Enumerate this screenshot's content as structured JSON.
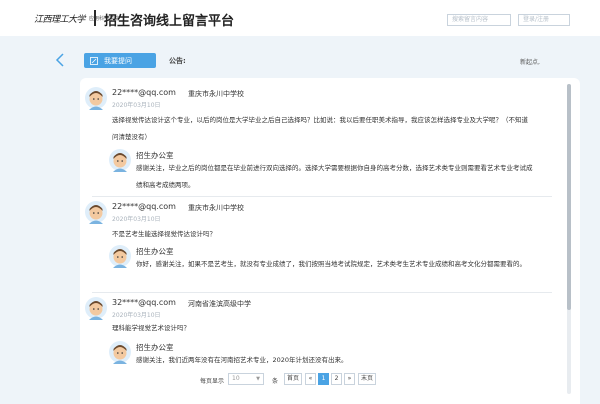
{
  "header": {
    "logo_text": "江西理工大学",
    "logo_sub": "应用科学学院",
    "title": "招生咨询线上留言平台",
    "search_placeholder": "搜索留言内容",
    "user_placeholder": "登录/注册"
  },
  "toolbar": {
    "ask_label": "我要提问",
    "notice_label": "公告:",
    "notice_text": "新起点,"
  },
  "messages": [
    {
      "email": "22****@qq.com",
      "school": "重庆市永川中学校",
      "date": "2020年03月10日",
      "question": "选择视觉传达设计这个专业，以后的岗位是大学毕业之后自己选择吗？比如说：我以后要任职美术指导，我应该怎样选择专业及大学呢？（不知道问清楚没有）",
      "reply_name": "招生办公室",
      "reply": "感谢关注，毕业之后的岗位都是在毕业前进行双向选择的。选择大学需要根据你自身的高考分数，选择艺术类专业则需要看艺术专业考试成绩和高考成绩两项。"
    },
    {
      "email": "22****@qq.com",
      "school": "重庆市永川中学校",
      "date": "2020年03月10日",
      "question": "不是艺考生能选择视觉传达设计吗？",
      "reply_name": "招生办公室",
      "reply": "你好，感谢关注，如果不是艺考生，就没有专业成绩了，我们按照当地考试院规定，艺术类考生艺术专业成绩和高考文化分都需要看的。"
    },
    {
      "email": "32****@qq.com",
      "school": "河南省淮滨高级中学",
      "date": "2020年03月10日",
      "question": "理科能学视觉艺术设计吗？",
      "reply_name": "招生办公室",
      "reply": "感谢关注，我们近两年没有在河南招艺术专业，2020年计划还没有出来。"
    }
  ],
  "pagination": {
    "per_page_label": "每页显示",
    "per_page_value": "10",
    "unit": "条",
    "first": "首页",
    "prev": "«",
    "pages": [
      "1",
      "2"
    ],
    "next": "»",
    "last": "末页",
    "current": "1"
  },
  "colors": {
    "accent": "#4aa3e4",
    "background": "#eef4f9"
  }
}
